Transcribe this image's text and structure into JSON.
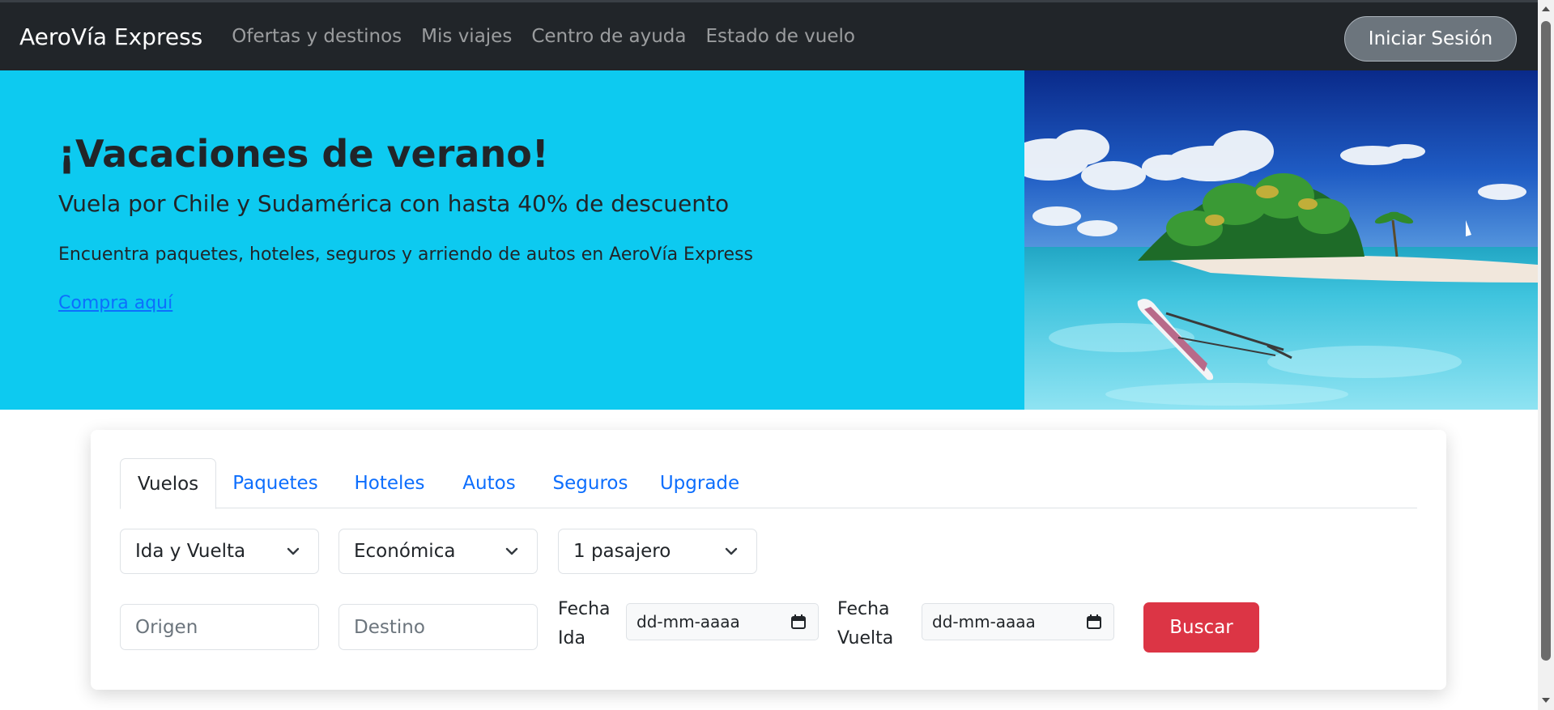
{
  "navbar": {
    "brand": "AeroVía Express",
    "links": [
      "Ofertas y destinos",
      "Mis viajes",
      "Centro de ayuda",
      "Estado de vuelo"
    ],
    "login_label": "Iniciar Sesión"
  },
  "hero": {
    "title": "¡Vacaciones de verano!",
    "subtitle": "Vuela por Chile y Sudamérica con hasta 40% de descuento",
    "description": "Encuentra paquetes, hoteles, seguros y arriendo de autos en AeroVía Express",
    "link_label": "Compra aquí",
    "image_icon": "tropical-island-photo"
  },
  "search": {
    "tabs": [
      {
        "label": "Vuelos",
        "active": true
      },
      {
        "label": "Paquetes",
        "active": false
      },
      {
        "label": "Hoteles",
        "active": false
      },
      {
        "label": "Autos",
        "active": false
      },
      {
        "label": "Seguros",
        "active": false
      },
      {
        "label": "Upgrade",
        "active": false
      }
    ],
    "trip_type": "Ida y Vuelta",
    "cabin_class": "Económica",
    "passengers": "1 pasajero",
    "origin_placeholder": "Origen",
    "destination_placeholder": "Destino",
    "departure_label_line1": "Fecha",
    "departure_label_line2": "Ida",
    "departure_value": "dd-mm-aaaa",
    "return_label_line1": "Fecha",
    "return_label_line2": "Vuelta",
    "return_value": "dd-mm-aaaa",
    "search_label": "Buscar"
  },
  "colors": {
    "navbar": "#212529",
    "hero": "#0dcaf0",
    "link": "#0d6efd",
    "search_button": "#dc3545"
  }
}
